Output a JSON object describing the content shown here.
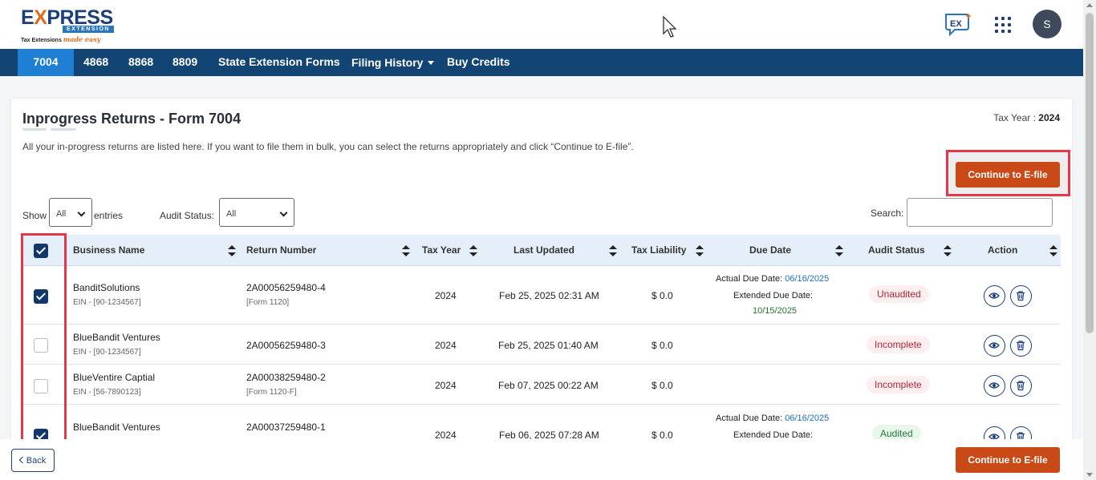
{
  "logo": {
    "word_e": "E",
    "word_x": "X",
    "word_rest": "PRESS",
    "band": "EXTENSION",
    "tagline": "Tax Extensions",
    "tagline_italic": "made easy"
  },
  "header": {
    "avatar_letter": "S"
  },
  "nav": {
    "items": [
      "7004",
      "4868",
      "8868",
      "8809",
      "State Extension Forms",
      "Filing History",
      "Buy Credits"
    ],
    "active": "7004"
  },
  "page": {
    "title": "Inprogress Returns - Form 7004",
    "tax_year_label": "Tax Year :",
    "tax_year_value": "2024",
    "description": "All your in-progress returns are listed here. If you want to file them in bulk, you can select the returns appropriately and click “Continue to E-file”.",
    "efile_label": "Continue to E-file"
  },
  "filters": {
    "show_label": "Show",
    "show_value": "All",
    "entries_label": "entries",
    "audit_label": "Audit Status:",
    "audit_value": "All",
    "search_label": "Search:"
  },
  "table": {
    "columns": [
      "Business Name",
      "Return Number",
      "Tax Year",
      "Last Updated",
      "Tax Liability",
      "Due Date",
      "Audit Status",
      "Action"
    ],
    "actual_due_label": "Actual Due Date:",
    "extended_due_label": "Extended Due Date:",
    "rows": [
      {
        "checked": true,
        "name": "BanditSolutions",
        "ein": "EIN - [90-1234567]",
        "return_number": "2A00056259480-4",
        "form": "[Form 1120]",
        "tax_year": "2024",
        "last_updated": "Feb 25, 2025 02:31 AM",
        "liability": "$ 0.0",
        "actual_due": "06/16/2025",
        "extended_due": "10/15/2025",
        "status": "Unaudited"
      },
      {
        "checked": false,
        "name": "BlueBandit Ventures",
        "ein": "EIN - [90-1234567]",
        "return_number": "2A00056259480-3",
        "form": "",
        "tax_year": "2024",
        "last_updated": "Feb 25, 2025 01:40 AM",
        "liability": "$ 0.0",
        "actual_due": "",
        "extended_due": "",
        "status": "Incomplete"
      },
      {
        "checked": false,
        "name": "BlueVentire Captial",
        "ein": "EIN - [56-7890123]",
        "return_number": "2A00038259480-2",
        "form": "[Form 1120-F]",
        "tax_year": "2024",
        "last_updated": "Feb 07, 2025 00:22 AM",
        "liability": "$ 0.0",
        "actual_due": "",
        "extended_due": "",
        "status": "Incomplete"
      },
      {
        "checked": true,
        "name": "BlueBandit Ventures",
        "ein": "",
        "return_number": "2A00037259480-1",
        "form": "",
        "tax_year": "2024",
        "last_updated": "Feb 06, 2025 07:28 AM",
        "liability": "$ 0.0",
        "actual_due": "06/16/2025",
        "extended_due": "",
        "status": "Audited"
      }
    ]
  },
  "footer": {
    "back_label": "Back",
    "efile_label": "Continue to E-file"
  },
  "colors": {
    "nav_bg": "#134574",
    "nav_active": "#1f7fd4",
    "primary_button": "#c94a16",
    "highlight_border": "#e3374a"
  }
}
